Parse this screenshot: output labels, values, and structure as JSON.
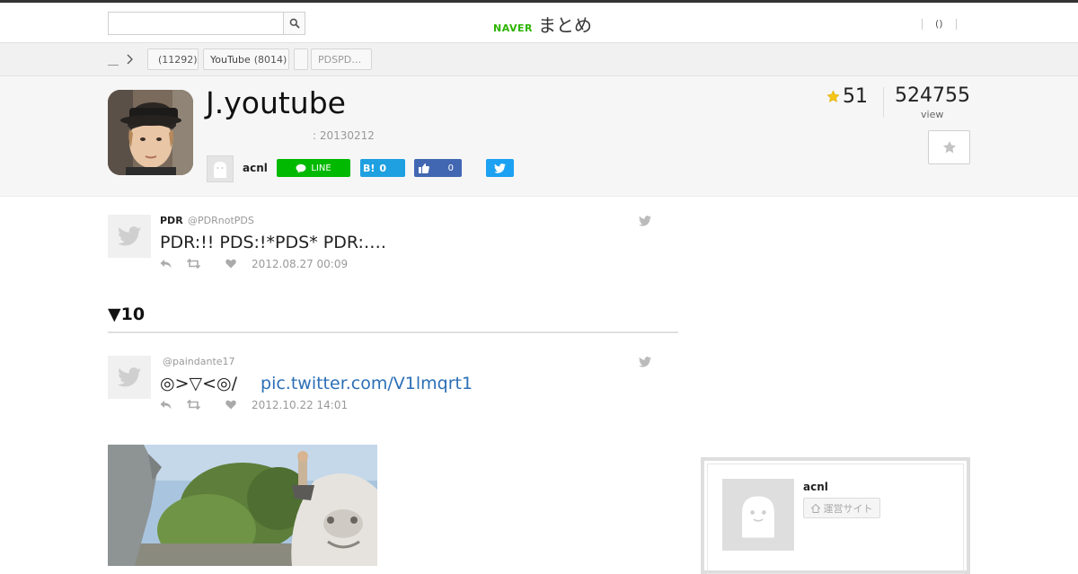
{
  "header": {
    "search_value": "",
    "search_placeholder": "",
    "logo_naver": "NAVER",
    "logo_matome": "まとめ",
    "right_link": "()"
  },
  "breadcrumb": {
    "home": "＿",
    "chips": [
      {
        "label": "",
        "count": "(11292)"
      },
      {
        "label": "YouTube",
        "count": "(8014)"
      },
      {
        "label": "",
        "count": ""
      },
      {
        "label": "PDSPD…",
        "count": ""
      }
    ]
  },
  "article": {
    "title": "J.youtube",
    "date": ": 20130212",
    "author": "acnl",
    "favorites": "51",
    "views": "524755",
    "view_label": "view",
    "share": {
      "line_label": "LINE",
      "hatena_label": "B!",
      "hatena_count": "0",
      "like_count": "0"
    }
  },
  "tweets": [
    {
      "name": "PDR",
      "handle": "@PDRnotPDS",
      "text": "PDR:!! PDS:!*PDS* PDR:….",
      "link": "",
      "date": "2012.08.27 00:09"
    },
    {
      "name": "",
      "handle": "@paindante17",
      "text": "◎>▽<◎/",
      "link": "pic.twitter.com/V1lmqrt1",
      "date": "2012.10.22 14:01"
    }
  ],
  "section": {
    "heading": "▼10"
  },
  "sidebar": {
    "author": "acnl",
    "site_button": "運営サイト"
  },
  "colors": {
    "naver_green": "#2db400",
    "line_green": "#00b900",
    "hatena_blue": "#1fa0e0",
    "facebook_blue": "#4267b2",
    "twitter_blue": "#1da1f2",
    "link_blue": "#2b6fb6",
    "star_yellow": "#f5c518"
  }
}
